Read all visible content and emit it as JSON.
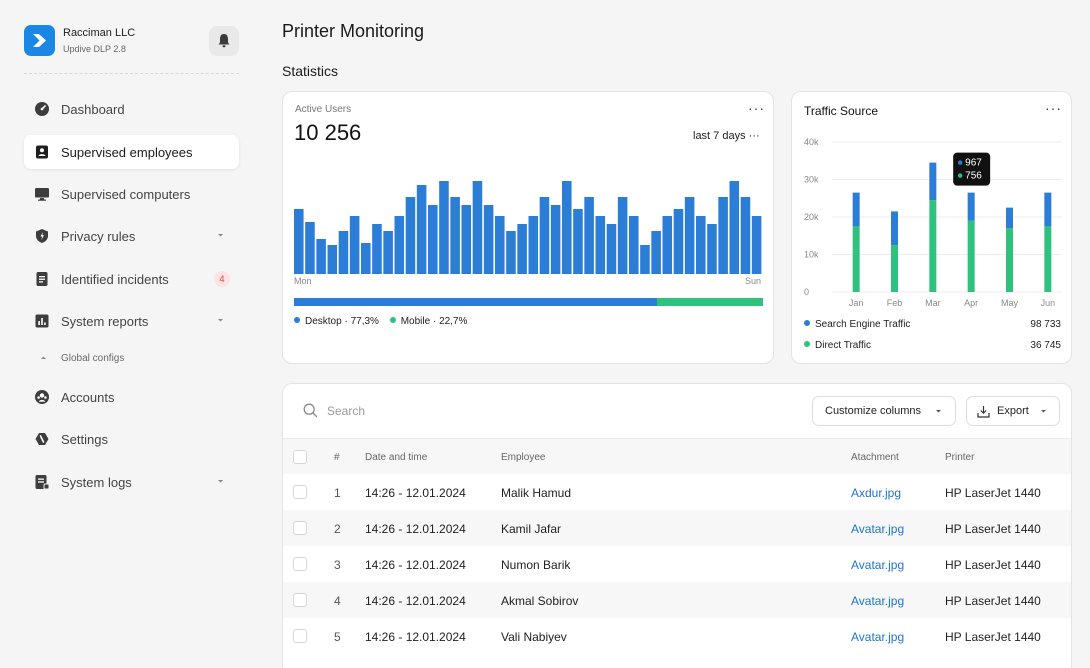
{
  "brand": {
    "name": "Racciman LLC",
    "version": "Updive DLP 2.8"
  },
  "colors": {
    "accent": "#1a86e6",
    "desktop": "#2c7dd6",
    "mobile": "#2ec27e",
    "search_engine": "#2c7dd6",
    "direct": "#2ec27e",
    "link": "#1f74cf",
    "badge": "#e14b3c"
  },
  "sidebar": {
    "items": [
      {
        "label": "Dashboard",
        "icon": "dashboard-icon",
        "active": false
      },
      {
        "label": "Supervised employees",
        "icon": "employee-badge-icon",
        "active": true
      },
      {
        "label": "Supervised computers",
        "icon": "monitor-icon",
        "active": false
      },
      {
        "label": "Privacy rules",
        "icon": "shield-icon",
        "active": false,
        "expandable": true
      },
      {
        "label": "Identified incidents",
        "icon": "document-icon",
        "active": false,
        "badge": "4"
      },
      {
        "label": "System reports",
        "icon": "bar-chart-icon",
        "active": false,
        "expandable": true
      },
      {
        "label": "Global configs",
        "icon": "chevron-up-icon",
        "sub": true
      },
      {
        "label": "Accounts",
        "icon": "accounts-icon",
        "active": false
      },
      {
        "label": "Settings",
        "icon": "settings-icon",
        "active": false
      },
      {
        "label": "System logs",
        "icon": "logs-icon",
        "active": false,
        "expandable": true
      }
    ]
  },
  "page": {
    "title": "Printer Monitoring",
    "section": "Statistics"
  },
  "active_users": {
    "label": "Active Users",
    "value": "10 256",
    "period": "last 7 days",
    "axis_start": "Mon",
    "axis_end": "Sun",
    "desktop_label": "Desktop · 77,3%",
    "mobile_label": "Mobile · 22,7%",
    "desktop_share": 0.773
  },
  "traffic": {
    "title": "Traffic Source",
    "tooltip": {
      "search_value": "967",
      "direct_value": "756"
    },
    "legend": [
      {
        "name": "Search Engine Traffic",
        "value": "98 733"
      },
      {
        "name": "Direct Traffic",
        "value": "36 745"
      }
    ]
  },
  "chart_data": [
    {
      "type": "bar",
      "title": "Active Users",
      "x_labels_shown": [
        "Mon",
        "Sun"
      ],
      "values": [
        65,
        52,
        35,
        29,
        43,
        58,
        31,
        50,
        43,
        58,
        77,
        89,
        69,
        93,
        77,
        69,
        93,
        69,
        58,
        43,
        50,
        58,
        77,
        69,
        93,
        65,
        77,
        58,
        50,
        77,
        58,
        29,
        43,
        58,
        65,
        77,
        58,
        50,
        77,
        93,
        77,
        58
      ],
      "ylim": [
        0,
        100
      ]
    },
    {
      "type": "bar",
      "stacked": true,
      "title": "Traffic Source",
      "categories": [
        "Jan",
        "Feb",
        "Mar",
        "Apr",
        "May",
        "Jun"
      ],
      "y_ticks": [
        "0",
        "10k",
        "20k",
        "30k",
        "40k"
      ],
      "ylim": [
        0,
        40000
      ],
      "series": [
        {
          "name": "Direct Traffic",
          "values": [
            17500,
            12500,
            24500,
            19000,
            17000,
            17500
          ]
        },
        {
          "name": "Search Engine Traffic",
          "values": [
            9000,
            9000,
            10000,
            7500,
            5500,
            9000
          ]
        }
      ]
    }
  ],
  "table": {
    "search_placeholder": "Search",
    "customize_label": "Customize columns",
    "export_label": "Export",
    "headers": {
      "num": "#",
      "date": "Date and time",
      "employee": "Employee",
      "attachment": "Atachment",
      "printer": "Printer"
    },
    "rows": [
      {
        "num": "1",
        "date": "14:26 - 12.01.2024",
        "employee": "Malik Hamud",
        "attachment": "Axdur.jpg",
        "printer": "HP LaserJet 1440"
      },
      {
        "num": "2",
        "date": "14:26 - 12.01.2024",
        "employee": "Kamil Jafar",
        "attachment": "Avatar.jpg",
        "printer": "HP LaserJet 1440"
      },
      {
        "num": "3",
        "date": "14:26 - 12.01.2024",
        "employee": "Numon Barik",
        "attachment": "Avatar.jpg",
        "printer": "HP LaserJet 1440"
      },
      {
        "num": "4",
        "date": "14:26 - 12.01.2024",
        "employee": "Akmal Sobirov",
        "attachment": "Avatar.jpg",
        "printer": "HP LaserJet 1440"
      },
      {
        "num": "5",
        "date": "14:26 - 12.01.2024",
        "employee": "Vali Nabiyev",
        "attachment": "Avatar.jpg",
        "printer": "HP LaserJet 1440"
      }
    ]
  }
}
